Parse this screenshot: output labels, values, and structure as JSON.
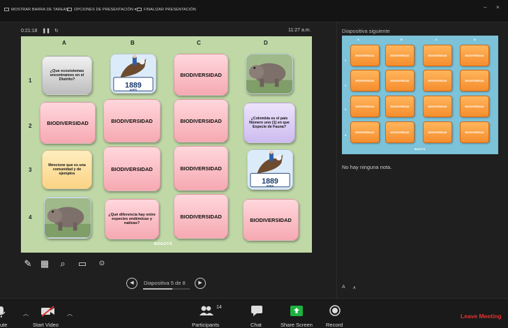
{
  "toolbar": {
    "items": [
      "MOSTRAR BARRA DE TAREAS",
      "OPCIONES DE PRESENTACIÓN ▾",
      "FINALIZAR PRESENTACIÓN"
    ],
    "minimize": "–",
    "close": "×"
  },
  "presenter": {
    "timer": "0:21:18",
    "clock": "11:27 a.m.",
    "next_slide_label": "Diapositiva siguiente",
    "notes": "No hay ninguna nota.",
    "slide_counter": "Diapositiva 5 de 8",
    "slide_index": 5,
    "slide_total": 8
  },
  "slide": {
    "columns": [
      "A",
      "B",
      "C",
      "D"
    ],
    "rows": [
      "1",
      "2",
      "3",
      "4"
    ],
    "cards": [
      [
        "¿Que ecosistemas encontramos en el Distrito?",
        "[image:bird-1889]",
        "BIODIVERSIDAD",
        "[image:hippo]"
      ],
      [
        "BIODIVERSIDAD",
        "BIODIVERSIDAD",
        "BIODIVERSIDAD",
        "¿Colombia es el país Número uno (1) en que Especie de Fauna?"
      ],
      [
        "Mencione que es una comunidad y de ejemplos",
        "BIODIVERSIDAD",
        "BIODIVERSIDAD",
        "[image:bird-1889]"
      ],
      [
        "[image:hippo]",
        "¿Qué diferencia hay entre especies endémicas y nativas?",
        "BIODIVERSIDAD",
        "BIODIVERSIDAD"
      ]
    ],
    "image_text": {
      "number": "1889",
      "sub": "AVES"
    },
    "logo": "BOGOTÁ"
  },
  "preview": {
    "columns": [
      "A",
      "B",
      "C",
      "D"
    ],
    "rows": [
      "1",
      "2",
      "3",
      "4"
    ],
    "card_label": "BIODIVERSIDAD",
    "logo": "BOGOTÁ"
  },
  "font_controls": [
    "A",
    "A"
  ],
  "meeting": {
    "audio_label": "ute",
    "video_label": "Start Video",
    "participants_label": "Participants",
    "participants_count": "14",
    "chat_label": "Chat",
    "share_label": "Share Screen",
    "record_label": "Record",
    "leave_label": "Leave Meeting"
  },
  "colors": {
    "slide_bg": "#bfd8a6",
    "preview_bg": "#7cc2d8",
    "leave": "#e5312e",
    "share": "#1fb141"
  }
}
